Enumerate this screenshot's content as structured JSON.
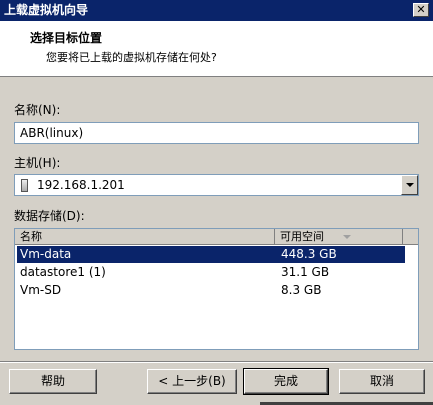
{
  "window": {
    "title": "上载虚拟机向导",
    "close_label": "✕"
  },
  "header": {
    "title": "选择目标位置",
    "subtitle": "您要将已上载的虚拟机存储在何处?"
  },
  "form": {
    "name_label": "名称(N):",
    "name_value": "ABR(linux)",
    "host_label": "主机(H):",
    "host_value": "192.168.1.201",
    "datastore_label": "数据存储(D):"
  },
  "datastores": {
    "columns": [
      "名称",
      "可用空间"
    ],
    "sorted_column": "可用空间",
    "rows": [
      {
        "name": "Vm-data",
        "free": "448.3 GB",
        "selected": true
      },
      {
        "name": "datastore1 (1)",
        "free": "31.1 GB",
        "selected": false
      },
      {
        "name": "Vm-SD",
        "free": "8.3 GB",
        "selected": false
      }
    ]
  },
  "buttons": {
    "help": "帮助",
    "back": "< 上一步(B)",
    "finish": "完成",
    "cancel": "取消"
  },
  "colors": {
    "titlebar": "#0a246a",
    "selection": "#0a246a",
    "face": "#d4d0c8"
  }
}
